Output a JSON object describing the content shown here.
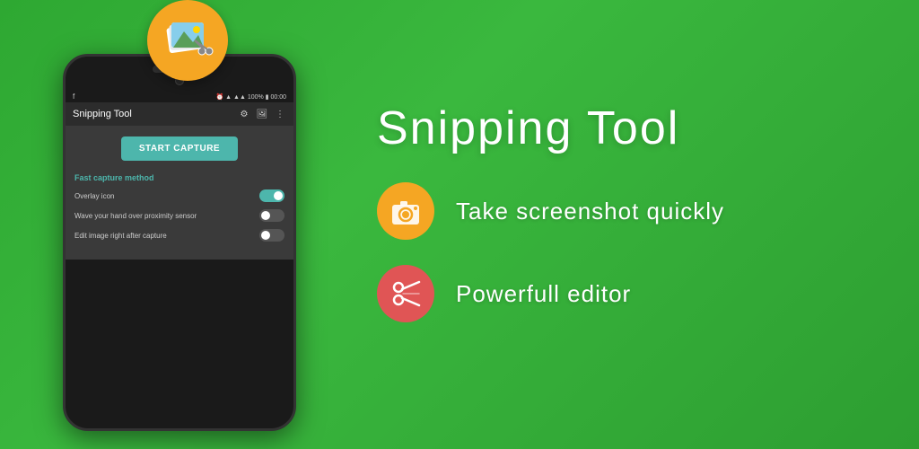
{
  "app": {
    "title": "Snipping Tool",
    "toolbar_title": "Snipping Tool"
  },
  "phone": {
    "status_left": "f",
    "status_right": "⏰ 📶 📶 100% 🔋 00:00",
    "start_button": "START CAPTURE",
    "section_label": "Fast capture method",
    "toggles": [
      {
        "label": "Overlay icon",
        "state": "on"
      },
      {
        "label": "Wave your hand over proximity sensor",
        "state": "off"
      },
      {
        "label": "Edit image right after capture",
        "state": "off"
      }
    ]
  },
  "features": [
    {
      "icon": "camera-icon",
      "text": "Take  screenshot  quickly",
      "color": "#f5a623"
    },
    {
      "icon": "scissors-icon",
      "text": "Powerfull  editor",
      "color": "#e05555"
    }
  ]
}
